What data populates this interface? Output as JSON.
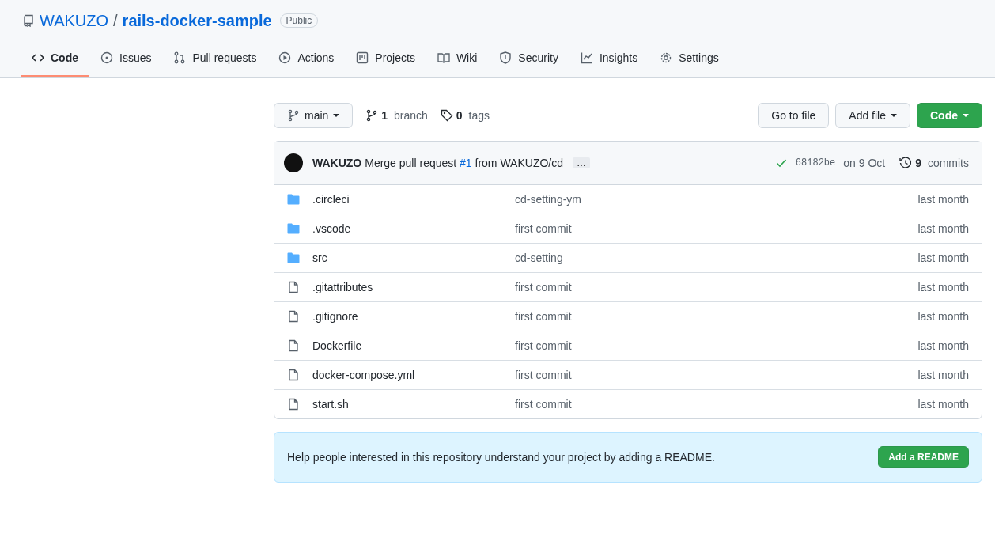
{
  "repo": {
    "owner": "WAKUZO",
    "separator": "/",
    "name": "rails-docker-sample",
    "visibility": "Public"
  },
  "tabs": [
    {
      "kind": "code",
      "label": "Code",
      "selected": true
    },
    {
      "kind": "issues",
      "label": "Issues",
      "selected": false
    },
    {
      "kind": "pulls",
      "label": "Pull requests",
      "selected": false
    },
    {
      "kind": "actions",
      "label": "Actions",
      "selected": false
    },
    {
      "kind": "projects",
      "label": "Projects",
      "selected": false
    },
    {
      "kind": "wiki",
      "label": "Wiki",
      "selected": false
    },
    {
      "kind": "security",
      "label": "Security",
      "selected": false
    },
    {
      "kind": "insights",
      "label": "Insights",
      "selected": false
    },
    {
      "kind": "settings",
      "label": "Settings",
      "selected": false
    }
  ],
  "toolbar": {
    "branch_button": "main",
    "branches": {
      "count": "1",
      "label": "branch"
    },
    "tags": {
      "count": "0",
      "label": "tags"
    },
    "go_to_file": "Go to file",
    "add_file": "Add file",
    "code": "Code"
  },
  "commit": {
    "author": "WAKUZO",
    "message_before": "Merge pull request ",
    "message_link": "#1",
    "message_after": " from WAKUZO/cd",
    "ellipsis": "…",
    "sha": "68182be",
    "date": "on 9 Oct",
    "commits_count": "9",
    "commits_label": "commits"
  },
  "files": [
    {
      "kind": "folder",
      "name": ".circleci",
      "message": "cd-setting-ym",
      "age": "last month"
    },
    {
      "kind": "folder",
      "name": ".vscode",
      "message": "first commit",
      "age": "last month"
    },
    {
      "kind": "folder",
      "name": "src",
      "message": "cd-setting",
      "age": "last month"
    },
    {
      "kind": "file",
      "name": ".gitattributes",
      "message": "first commit",
      "age": "last month"
    },
    {
      "kind": "file",
      "name": ".gitignore",
      "message": "first commit",
      "age": "last month"
    },
    {
      "kind": "file",
      "name": "Dockerfile",
      "message": "first commit",
      "age": "last month"
    },
    {
      "kind": "file",
      "name": "docker-compose.yml",
      "message": "first commit",
      "age": "last month"
    },
    {
      "kind": "file",
      "name": "start.sh",
      "message": "first commit",
      "age": "last month"
    }
  ],
  "readme_notice": {
    "text": "Help people interested in this repository understand your project by adding a README.",
    "button": "Add a README"
  }
}
